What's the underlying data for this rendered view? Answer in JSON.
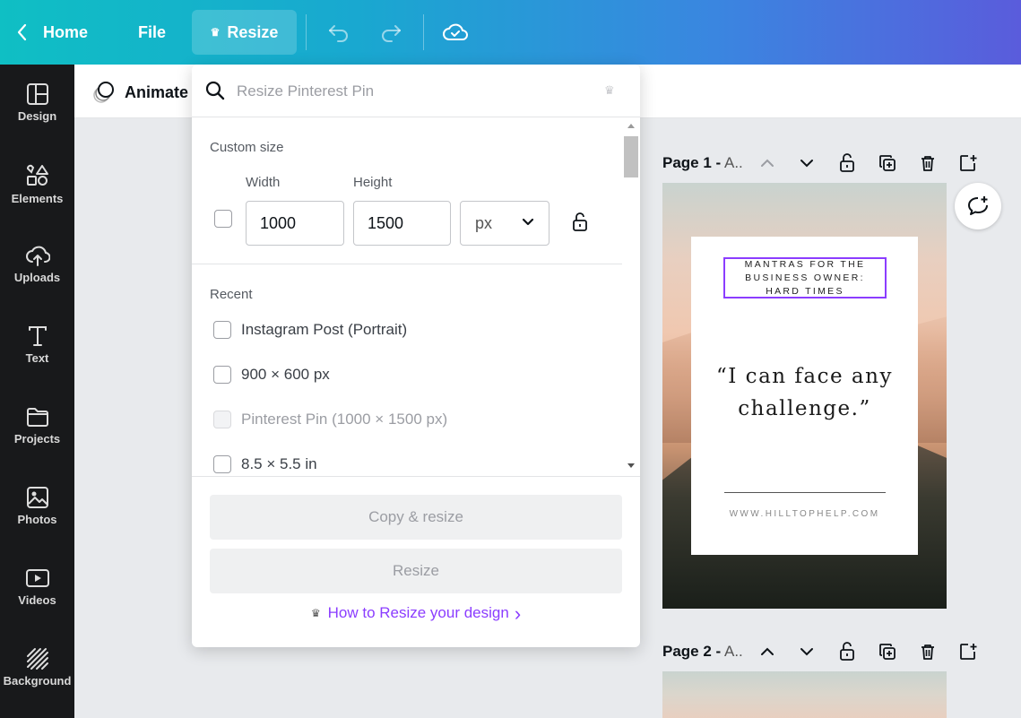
{
  "topbar": {
    "home_label": "Home",
    "file_label": "File",
    "resize_label": "Resize",
    "crown_glyph": "♛"
  },
  "sidebar": {
    "items": [
      {
        "label": "Design",
        "icon": "layout-icon"
      },
      {
        "label": "Elements",
        "icon": "shapes-icon"
      },
      {
        "label": "Uploads",
        "icon": "cloud-upload-icon"
      },
      {
        "label": "Text",
        "icon": "text-icon"
      },
      {
        "label": "Projects",
        "icon": "folder-icon"
      },
      {
        "label": "Photos",
        "icon": "image-icon"
      },
      {
        "label": "Videos",
        "icon": "video-icon"
      },
      {
        "label": "Background",
        "icon": "pattern-icon"
      }
    ]
  },
  "subbar": {
    "animate_label": "Animate"
  },
  "resize_panel": {
    "search_placeholder": "Resize Pinterest Pin",
    "custom_size_label": "Custom size",
    "width_label": "Width",
    "height_label": "Height",
    "width_value": "1000",
    "height_value": "1500",
    "unit_value": "px",
    "recent_label": "Recent",
    "recent_items": [
      {
        "label": "Instagram Post (Portrait)",
        "disabled": false
      },
      {
        "label": "900 × 600 px",
        "disabled": false
      },
      {
        "label": "Pinterest Pin (1000 × 1500 px)",
        "disabled": true
      },
      {
        "label": "8.5 × 5.5 in",
        "disabled": false
      }
    ],
    "copy_resize_label": "Copy & resize",
    "resize_label": "Resize",
    "howto_label": "How to Resize your design",
    "howto_arrow": "›"
  },
  "pages": [
    {
      "prefix": "Page 1 -",
      "title_rest": " A.."
    },
    {
      "prefix": "Page 2 -",
      "title_rest": " A.."
    }
  ],
  "design": {
    "mantra_text": "MANTRAS FOR THE BUSINESS OWNER: HARD TIMES",
    "quote_text": "“I can face any challenge.”",
    "website": "WWW.HILLTOPHELP.COM"
  },
  "colors": {
    "accent_purple": "#8b3dff",
    "sidebar_bg": "#18191b",
    "topbar_start": "#0fbfc4",
    "topbar_end": "#5a5cdc"
  }
}
